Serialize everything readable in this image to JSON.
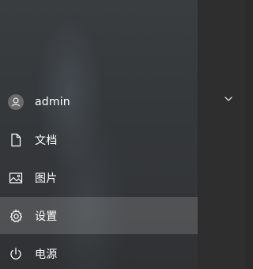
{
  "start_menu": {
    "user": {
      "label": "admin",
      "icon": "user-avatar-icon"
    },
    "items": [
      {
        "label": "文档",
        "icon": "document-icon"
      },
      {
        "label": "图片",
        "icon": "pictures-icon"
      },
      {
        "label": "设置",
        "icon": "gear-icon",
        "selected": true
      },
      {
        "label": "电源",
        "icon": "power-icon"
      }
    ]
  },
  "app_panel": {
    "expand_icon": "chevron-down-icon"
  },
  "colors": {
    "text": "#ffffff",
    "selected_bg": "rgba(255,255,255,0.15)",
    "panel_bg": "#2e2e2e"
  }
}
